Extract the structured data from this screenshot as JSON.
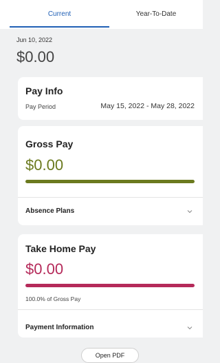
{
  "tabs": {
    "current": "Current",
    "ytd": "Year-To-Date"
  },
  "summary": {
    "date": "Jun 10, 2022",
    "total": "$0.00"
  },
  "pay_info": {
    "title": "Pay Info",
    "period_label": "Pay Period",
    "period_value": "May 15, 2022 - May 28, 2022"
  },
  "gross_pay": {
    "title": "Gross Pay",
    "amount": "$0.00",
    "progress_fraction": 1.0,
    "color": "#6b7a1f",
    "absence_label": "Absence Plans"
  },
  "take_home": {
    "title": "Take Home Pay",
    "amount": "$0.00",
    "progress_fraction": 1.0,
    "color": "#b52a5a",
    "percent_note": "100.0% of Gross Pay",
    "payment_label": "Payment Information"
  },
  "footer": {
    "open_pdf": "Open PDF"
  },
  "icons": {
    "chevron": "chevron-down-icon"
  },
  "accent": "#1f5fb5"
}
